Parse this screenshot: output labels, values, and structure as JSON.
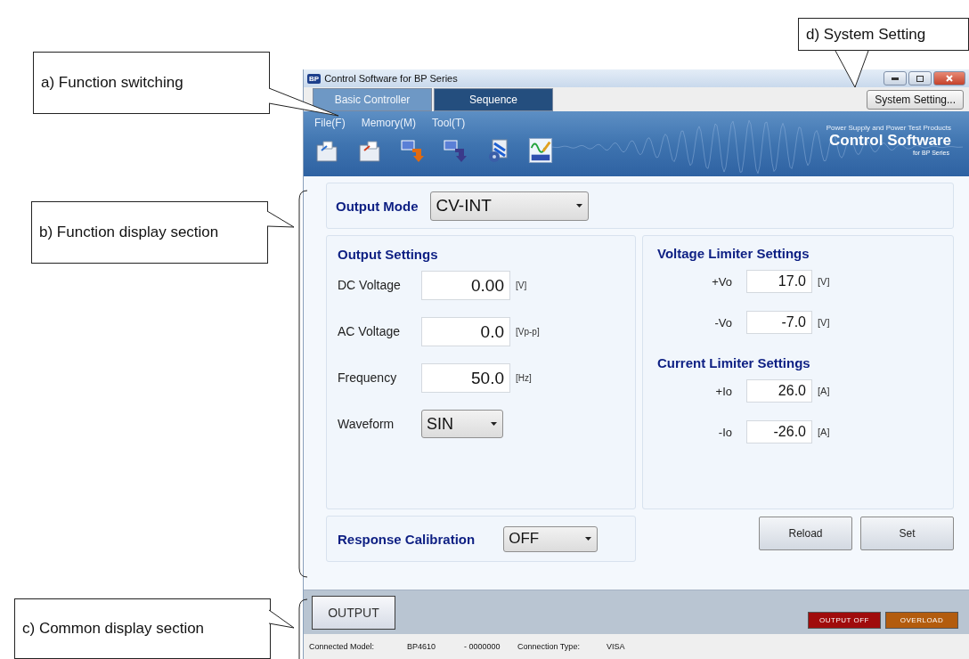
{
  "callouts": [
    {
      "label": "a) Function switching"
    },
    {
      "label": "b) Function display section"
    },
    {
      "label": "c) Common display section"
    },
    {
      "label": "d) System Setting"
    }
  ],
  "window": {
    "title": "Control Software for BP Series",
    "app_icon_text": "BP"
  },
  "tabs": [
    {
      "label": "Basic Controller",
      "selected": true
    },
    {
      "label": "Sequence",
      "selected": false
    }
  ],
  "system_setting_button": "System Setting...",
  "menu": [
    "File(F)",
    "Memory(M)",
    "Tool(T)"
  ],
  "banner": {
    "tagline": "Power Supply and Power Test Products",
    "product": "Control Software",
    "subtitle": "for BP Series"
  },
  "output_mode": {
    "label": "Output Mode",
    "value": "CV-INT"
  },
  "output_settings": {
    "title": "Output Settings",
    "rows": [
      {
        "kind": "field",
        "label": "DC Voltage",
        "value": "0.00",
        "unit": "[V]"
      },
      {
        "kind": "field",
        "label": "AC Voltage",
        "value": "0.0",
        "unit": "[Vp-p]"
      },
      {
        "kind": "field",
        "label": "Frequency",
        "value": "50.0",
        "unit": "[Hz]"
      },
      {
        "kind": "dropdown",
        "label": "Waveform",
        "value": "SIN"
      }
    ]
  },
  "limiters": [
    {
      "title": "Voltage Limiter Settings",
      "rows": [
        {
          "label": "+Vo",
          "value": "17.0",
          "unit": "[V]"
        },
        {
          "label": "-Vo",
          "value": "-7.0",
          "unit": "[V]"
        }
      ]
    },
    {
      "title": "Current Limiter Settings",
      "rows": [
        {
          "label": "+Io",
          "value": "26.0",
          "unit": "[A]"
        },
        {
          "label": "-Io",
          "value": "-26.0",
          "unit": "[A]"
        }
      ]
    }
  ],
  "response_calibration": {
    "label": "Response Calibration",
    "value": "OFF"
  },
  "buttons": [
    "Reload",
    "Set"
  ],
  "output_button": "OUTPUT",
  "indicators": [
    {
      "label": "OUTPUT OFF",
      "color": "#a00c0c"
    },
    {
      "label": "OVERLOAD",
      "color": "#b35c0e"
    }
  ],
  "status_bar": {
    "model_label": "Connected Model:",
    "model": "BP4610",
    "serial": "- 0000000",
    "connection_label": "Connection Type:",
    "connection": "VISA"
  }
}
